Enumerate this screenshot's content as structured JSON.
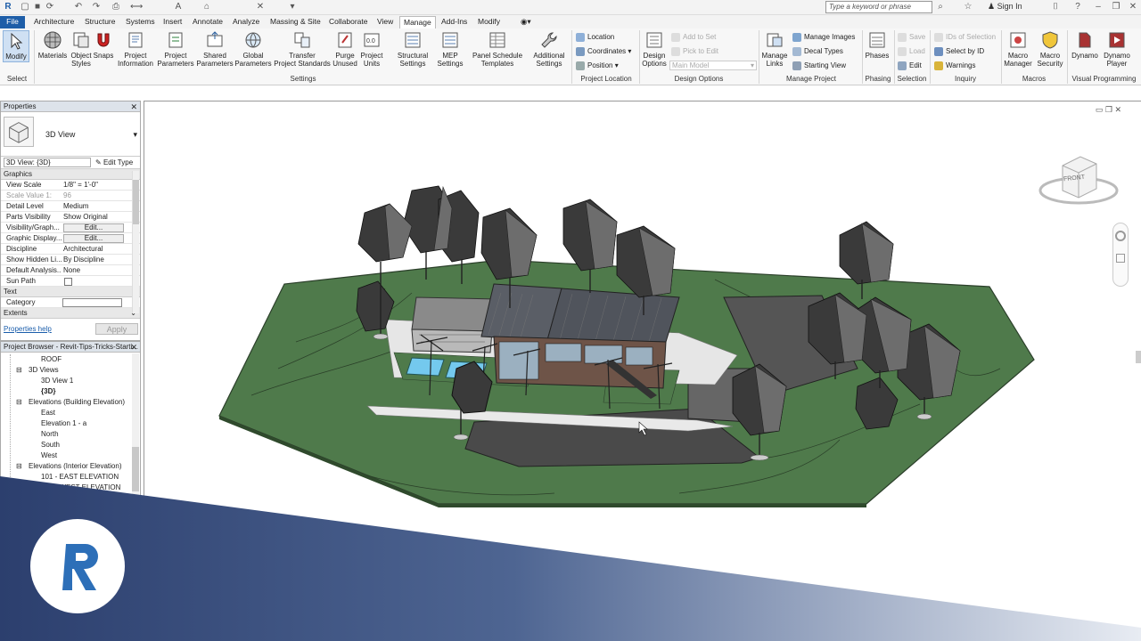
{
  "search": {
    "placeholder": "Type a keyword or phrase"
  },
  "signin": "Sign In",
  "tabs": [
    "File",
    "Architecture",
    "Structure",
    "Systems",
    "Insert",
    "Annotate",
    "Analyze",
    "Massing & Site",
    "Collaborate",
    "View",
    "Manage",
    "Add-Ins",
    "Modify"
  ],
  "active_tab": "Manage",
  "ribbon": {
    "select": {
      "modify": "Modify",
      "select": "Select"
    },
    "settings": {
      "materials": "Materials",
      "object_styles": "Object\nStyles",
      "snaps": "Snaps",
      "project_info": "Project\nInformation",
      "project_params": "Project\nParameters",
      "shared_params": "Shared\nParameters",
      "global_params": "Global\nParameters",
      "transfer": "Transfer\nProject Standards",
      "purge": "Purge\nUnused",
      "units": "Project\nUnits",
      "structural": "Structural\nSettings",
      "mep": "MEP\nSettings",
      "panel": "Panel Schedule\nTemplates",
      "additional": "Additional\nSettings",
      "panel_label": "Settings"
    },
    "location": {
      "location": "Location",
      "coordinates": "Coordinates",
      "position": "Position",
      "panel_label": "Project Location"
    },
    "design_options": {
      "btn": "Design\nOptions",
      "add_to_set": "Add to Set",
      "pick_to_edit": "Pick to Edit",
      "main_model": "Main Model",
      "panel_label": "Design Options"
    },
    "manage_project": {
      "manage_links": "Manage\nLinks",
      "manage_images": "Manage Images",
      "decal_types": "Decal Types",
      "starting_view": "Starting View",
      "panel_label": "Manage Project"
    },
    "phasing": {
      "phases": "Phases",
      "panel_label": "Phasing"
    },
    "selection": {
      "save": "Save",
      "load": "Load",
      "edit": "Edit",
      "panel_label": "Selection"
    },
    "inquiry": {
      "ids": "IDs of Selection",
      "select_by_id": "Select by ID",
      "warnings": "Warnings",
      "panel_label": "Inquiry"
    },
    "macros": {
      "manager": "Macro\nManager",
      "security": "Macro\nSecurity",
      "panel_label": "Macros"
    },
    "visual": {
      "dynamo": "Dynamo",
      "player": "Dynamo\nPlayer",
      "panel_label": "Visual Programming"
    }
  },
  "properties": {
    "title": "Properties",
    "type_name": "3D View",
    "view_select": "3D View: {3D}",
    "edit_type": "Edit Type",
    "group_graphics": "Graphics",
    "rows": [
      {
        "k": "View Scale",
        "v": "1/8\" = 1'-0\""
      },
      {
        "k": "Scale Value    1:",
        "v": "96"
      },
      {
        "k": "Detail Level",
        "v": "Medium"
      },
      {
        "k": "Parts Visibility",
        "v": "Show Original"
      },
      {
        "k": "Visibility/Graph...",
        "v": "Edit..."
      },
      {
        "k": "Graphic Display...",
        "v": "Edit..."
      },
      {
        "k": "Discipline",
        "v": "Architectural"
      },
      {
        "k": "Show Hidden Li...",
        "v": "By Discipline"
      },
      {
        "k": "Default Analysis...",
        "v": "None"
      },
      {
        "k": "Sun Path",
        "v": ""
      }
    ],
    "group_text": "Text",
    "category": "Category",
    "group_extents": "Extents",
    "help": "Properties help",
    "apply": "Apply"
  },
  "browser": {
    "title": "Project Browser - Revit-Tips-Tricks-Starti...",
    "items": [
      "ROOF",
      "3D Views",
      "3D View 1",
      "{3D}",
      "Elevations (Building Elevation)",
      "East",
      "Elevation 1 - a",
      "North",
      "South",
      "West",
      "Elevations (Interior Elevation)",
      "101 - EAST ELEVATION",
      "101 - WEST ELEVATION"
    ]
  },
  "viewcube": {
    "face": "FRONT"
  },
  "logo": {
    "letter": "R"
  },
  "colors": {
    "file_tab": "#1e5ea8",
    "terrain": "#4f7a4b",
    "overlay": "#3e5a8c"
  }
}
